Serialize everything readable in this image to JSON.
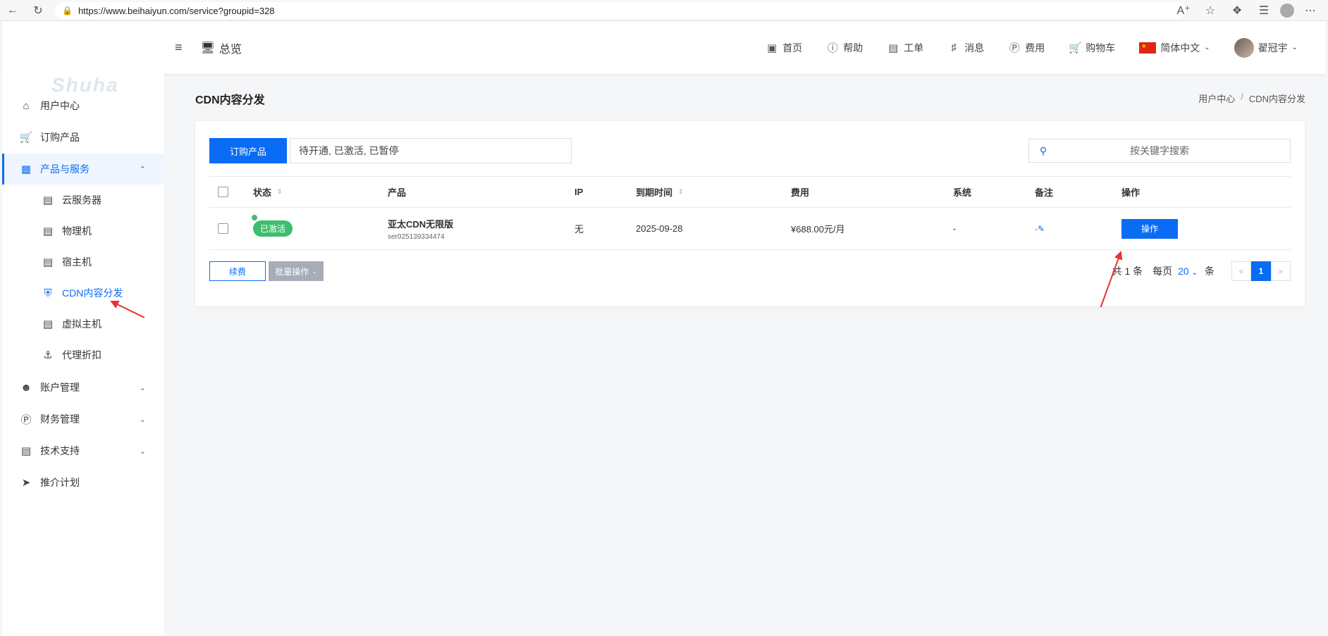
{
  "browser": {
    "url": "https://www.beihaiyun.com/service?groupid=328"
  },
  "header": {
    "overview_label": "总览",
    "nav": [
      {
        "label": "首页",
        "icon": "monitor-icon"
      },
      {
        "label": "帮助",
        "icon": "help-icon"
      },
      {
        "label": "工单",
        "icon": "ticket-icon"
      },
      {
        "label": "消息",
        "icon": "bell-icon"
      },
      {
        "label": "费用",
        "icon": "dollar-icon"
      },
      {
        "label": "购物车",
        "icon": "cart-icon"
      }
    ],
    "language": "简体中文",
    "username": "翟冠宇"
  },
  "sidebar": {
    "logo_text": "Shuha",
    "items": [
      {
        "label": "用户中心",
        "icon": "home-icon"
      },
      {
        "label": "订购产品",
        "icon": "cart-icon"
      },
      {
        "label": "产品与服务",
        "icon": "grid-icon"
      },
      {
        "label": "云服务器",
        "icon": "server-icon"
      },
      {
        "label": "物理机",
        "icon": "server-icon"
      },
      {
        "label": "宿主机",
        "icon": "server-icon"
      },
      {
        "label": "CDN内容分发",
        "icon": "shield-icon"
      },
      {
        "label": "虚拟主机",
        "icon": "server-icon"
      },
      {
        "label": "代理折扣",
        "icon": "anchor-icon"
      },
      {
        "label": "账户管理",
        "icon": "user-icon"
      },
      {
        "label": "财务管理",
        "icon": "dollar-icon"
      },
      {
        "label": "技术支持",
        "icon": "ticket-icon"
      },
      {
        "label": "推介计划",
        "icon": "send-icon"
      }
    ]
  },
  "main": {
    "title": "CDN内容分发",
    "breadcrumb": [
      "用户中心",
      "CDN内容分发"
    ],
    "order_button": "订购产品",
    "filter_value": "待开通, 已激活, 已暂停",
    "search_placeholder": "按关键字搜索",
    "table": {
      "headers": [
        "状态",
        "产品",
        "IP",
        "到期时间",
        "费用",
        "系统",
        "备注",
        "操作"
      ],
      "rows": [
        {
          "status": "已激活",
          "product": "亚太CDN无限版",
          "product_id": "ser025139334474",
          "ip": "无",
          "expiry": "2025-09-28",
          "fee": "¥688.00元/月",
          "system": "-",
          "note": "-",
          "action": "操作"
        }
      ]
    },
    "renew_button": "续费",
    "batch_button": "批量操作",
    "pagination": {
      "total_text": "共 1 条",
      "per_page_label": "每页",
      "per_page_value": "20",
      "per_page_unit": "条",
      "prev": "«",
      "current": "1",
      "next": "»"
    }
  },
  "colors": {
    "primary": "#0a6cf5",
    "success": "#3dbd6e",
    "annotation": "#e8332f"
  }
}
